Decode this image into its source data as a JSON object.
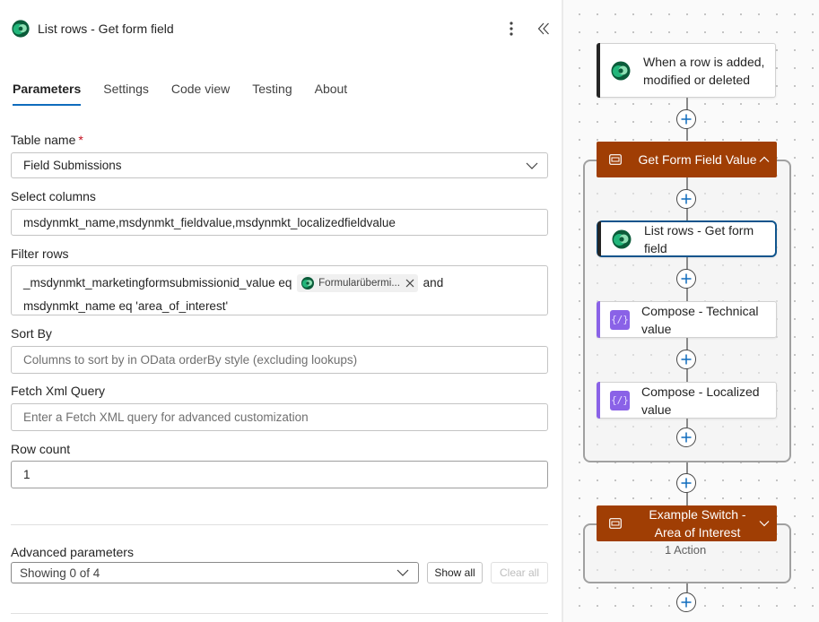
{
  "panel": {
    "title": "List rows - Get form field",
    "tabs": [
      {
        "label": "Parameters",
        "active": true
      },
      {
        "label": "Settings",
        "active": false
      },
      {
        "label": "Code view",
        "active": false
      },
      {
        "label": "Testing",
        "active": false
      },
      {
        "label": "About",
        "active": false
      }
    ],
    "table_name": {
      "label": "Table name",
      "required_mark": "*",
      "value": "Field Submissions"
    },
    "select_columns": {
      "label": "Select columns",
      "value": "msdynmkt_name,msdynmkt_fieldvalue,msdynmkt_localizedfieldvalue"
    },
    "filter_rows": {
      "label": "Filter rows",
      "line1_prefix": "_msdynmkt_marketingformsubmissionid_value eq",
      "token": "Formularübermi...",
      "line1_suffix": "and",
      "line2": "msdynmkt_name eq 'area_of_interest'"
    },
    "sort_by": {
      "label": "Sort By",
      "placeholder": "Columns to sort by in OData orderBy style (excluding lookups)"
    },
    "fetch_xml": {
      "label": "Fetch Xml Query",
      "placeholder": "Enter a Fetch XML query for advanced customization"
    },
    "row_count": {
      "label": "Row count",
      "value": "1"
    },
    "advanced": {
      "label": "Advanced parameters",
      "selected": "Showing 0 of 4",
      "show_all": "Show all",
      "clear_all": "Clear all"
    }
  },
  "canvas": {
    "trigger": {
      "label": "When a row is added, modified or deleted"
    },
    "scope1": {
      "label": "Get Form Field Value"
    },
    "action1": {
      "label": "List rows - Get form field"
    },
    "action2": {
      "label": "Compose - Technical value"
    },
    "action3": {
      "label": "Compose - Localized value"
    },
    "scope2": {
      "label": "Example Switch - Area of Interest",
      "sub": "1 Action"
    }
  },
  "colors": {
    "accent": "#0f6cbd",
    "scope_header": "#a03e04",
    "compose": "#8a62e7",
    "required": "#c50f1f"
  },
  "icons": {
    "dataverse": "dataverse-icon",
    "more": "more-vertical-icon",
    "collapse": "double-chevron-left-icon",
    "compose": "compose-icon",
    "scope": "scope-icon",
    "add": "plus-icon"
  }
}
